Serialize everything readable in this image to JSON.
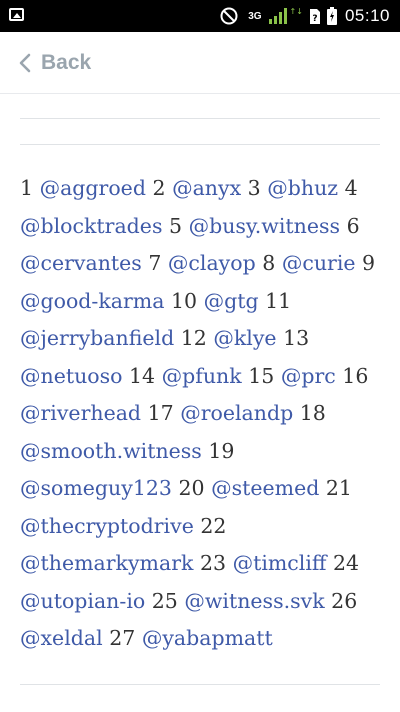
{
  "status_bar": {
    "network": "3G",
    "time": "05:10",
    "icons": [
      "gallery-icon",
      "do-not-disturb-icon",
      "signal-icon",
      "sim-icon",
      "battery-icon"
    ]
  },
  "nav": {
    "back_label": "Back",
    "back_icon": "chevron-left-icon"
  },
  "witnesses": [
    {
      "rank": "1",
      "handle": "@aggroed"
    },
    {
      "rank": "2",
      "handle": "@anyx"
    },
    {
      "rank": "3",
      "handle": "@bhuz"
    },
    {
      "rank": "4",
      "handle": "@blocktrades"
    },
    {
      "rank": "5",
      "handle": "@busy.witness"
    },
    {
      "rank": "6",
      "handle": "@cervantes"
    },
    {
      "rank": "7",
      "handle": "@clayop"
    },
    {
      "rank": "8",
      "handle": "@curie"
    },
    {
      "rank": "9",
      "handle": "@good-karma"
    },
    {
      "rank": "10",
      "handle": "@gtg"
    },
    {
      "rank": "11",
      "handle": "@jerrybanfield"
    },
    {
      "rank": "12",
      "handle": "@klye"
    },
    {
      "rank": "13",
      "handle": "@netuoso"
    },
    {
      "rank": "14",
      "handle": "@pfunk"
    },
    {
      "rank": "15",
      "handle": "@prc"
    },
    {
      "rank": "16",
      "handle": "@riverhead"
    },
    {
      "rank": "17",
      "handle": "@roelandp"
    },
    {
      "rank": "18",
      "handle": "@smooth.witness"
    },
    {
      "rank": "19",
      "handle": "@someguy123"
    },
    {
      "rank": "20",
      "handle": "@steemed"
    },
    {
      "rank": "21",
      "handle": "@thecryptodrive"
    },
    {
      "rank": "22",
      "handle": "@themarkymark"
    },
    {
      "rank": "23",
      "handle": "@timcliff"
    },
    {
      "rank": "24",
      "handle": "@utopian-io"
    },
    {
      "rank": "25",
      "handle": "@witness.svk"
    },
    {
      "rank": "26",
      "handle": "@xeldal"
    },
    {
      "rank": "27",
      "handle": "@yabapmatt"
    }
  ],
  "colors": {
    "link": "#3f5aa8",
    "text": "#333333",
    "back": "#9aa5ae",
    "divider": "#e0e3e6"
  }
}
